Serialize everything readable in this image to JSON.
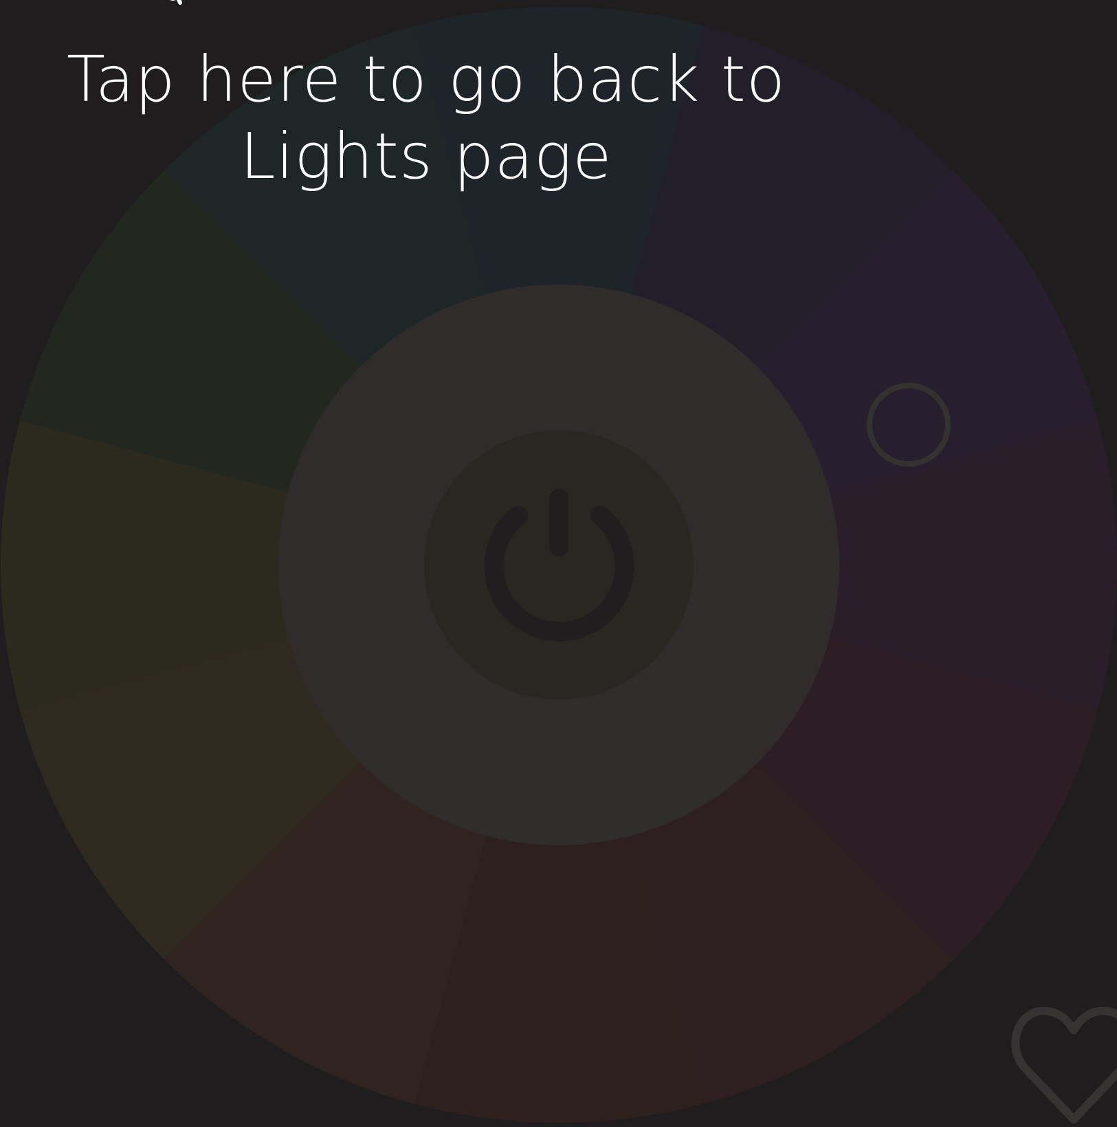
{
  "overlay": {
    "tooltip_line1": "Tap here to go back to",
    "tooltip_line2": "Lights page"
  },
  "color_wheel": {
    "segment_colors": [
      "#1f232a",
      "#221f2b",
      "#271f2d",
      "#2b1e2b",
      "#2c1e24",
      "#2e1f21",
      "#2d201f",
      "#2f2420",
      "#2f2a1f",
      "#2b2a1d",
      "#22281f",
      "#1f2627"
    ],
    "inner_ring_color": "#302c2b",
    "selector_ring_color": "#34322f"
  },
  "icons": {
    "power": "power-icon",
    "selector": "color-selector-ring",
    "favorite": "heart-icon"
  }
}
